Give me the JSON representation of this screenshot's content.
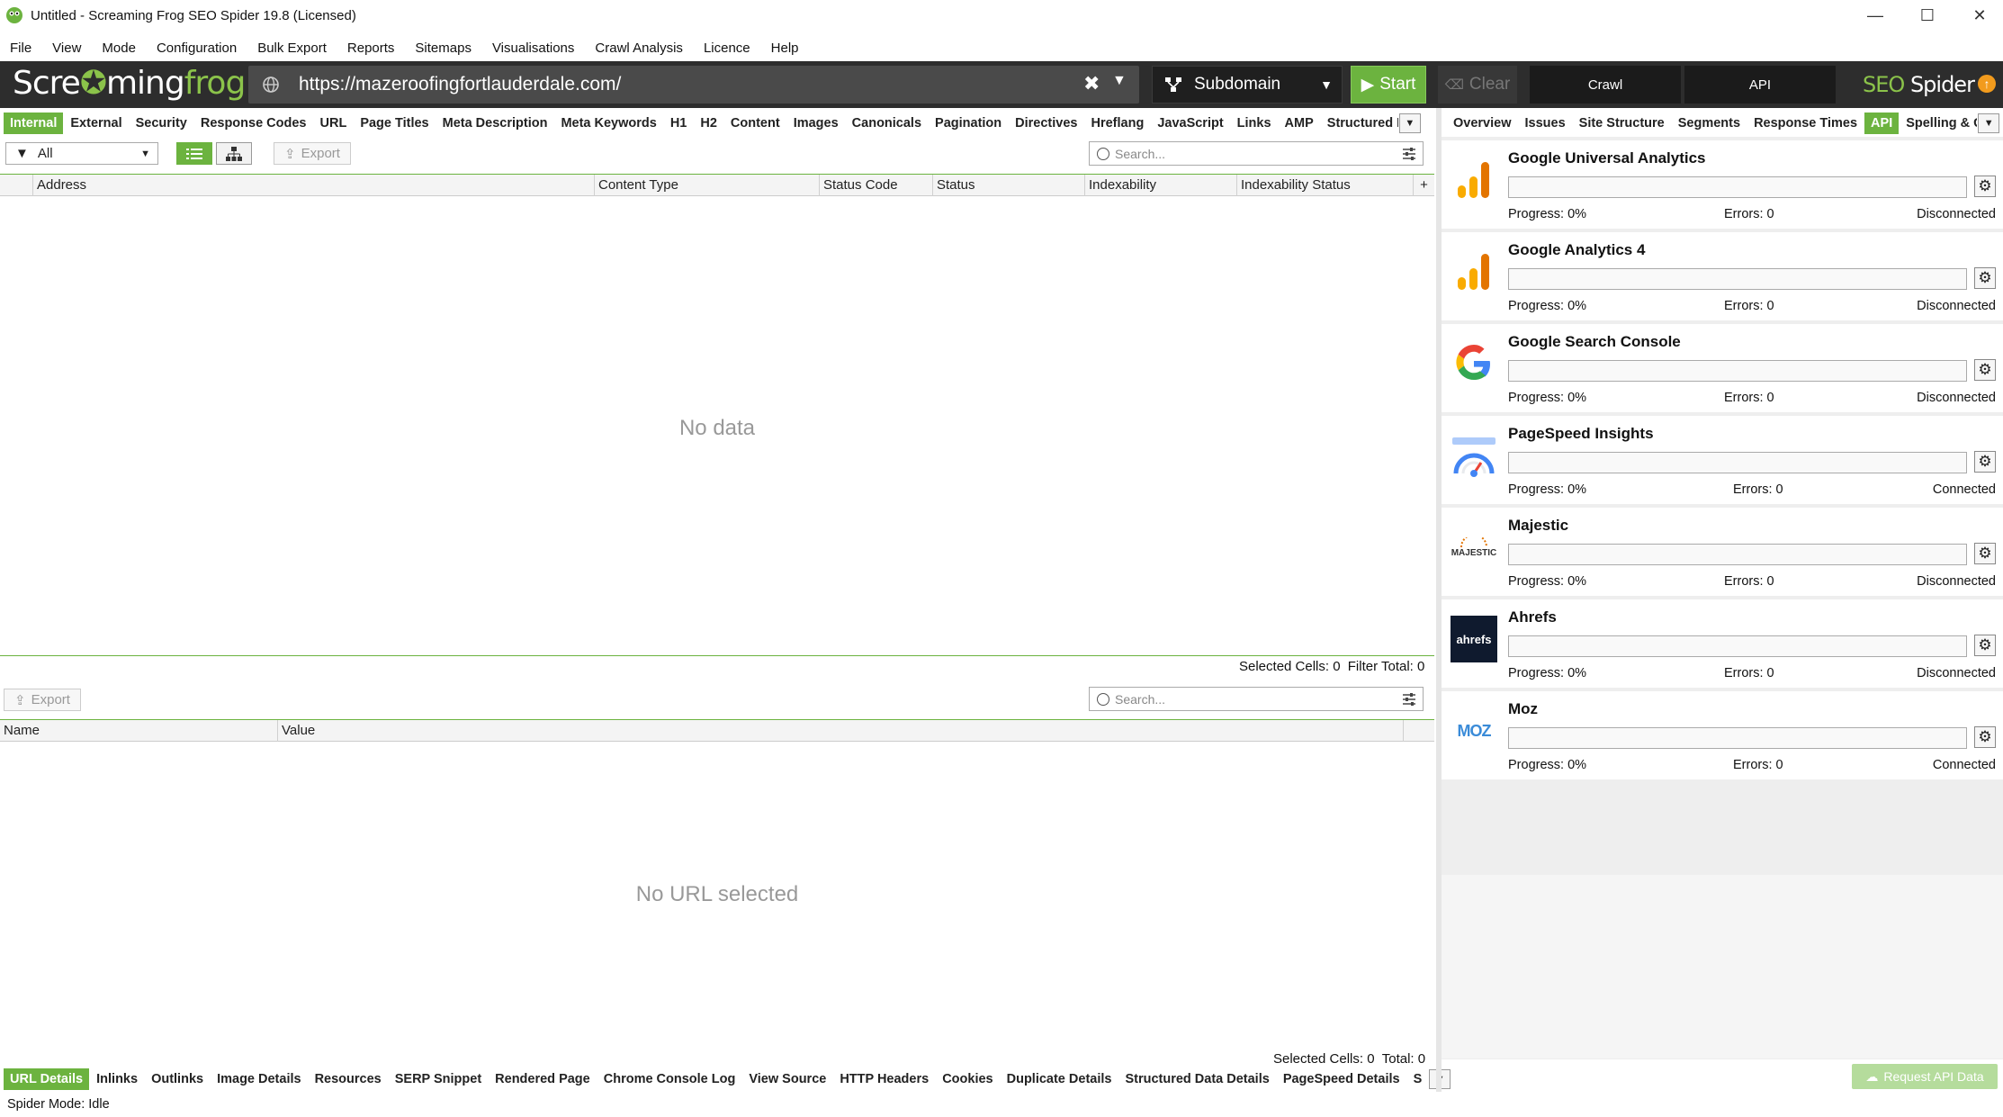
{
  "window": {
    "title": "Untitled - Screaming Frog SEO Spider 19.8 (Licensed)",
    "minimize": "—",
    "maximize": "☐",
    "close": "✕"
  },
  "menu": [
    "File",
    "View",
    "Mode",
    "Configuration",
    "Bulk Export",
    "Reports",
    "Sitemaps",
    "Visualisations",
    "Crawl Analysis",
    "Licence",
    "Help"
  ],
  "toolbar": {
    "logo_part1": "Scre",
    "logo_part2": "ming",
    "logo_part3": "frog",
    "url": "https://mazeroofingfortlauderdale.com/",
    "crawl_scope": "Subdomain",
    "start_label": "Start",
    "clear_label": "Clear",
    "crawl_mode": "Crawl",
    "api_mode": "API",
    "brand_seo": "SEO",
    "brand_spider": "Spider"
  },
  "main_tabs": [
    "Internal",
    "External",
    "Security",
    "Response Codes",
    "URL",
    "Page Titles",
    "Meta Description",
    "Meta Keywords",
    "H1",
    "H2",
    "Content",
    "Images",
    "Canonicals",
    "Pagination",
    "Directives",
    "Hreflang",
    "JavaScript",
    "Links",
    "AMP",
    "Structured D"
  ],
  "right_tabs": [
    "Overview",
    "Issues",
    "Site Structure",
    "Segments",
    "Response Times",
    "API",
    "Spelling & G"
  ],
  "filter": {
    "value": "All",
    "export_label": "Export",
    "search_placeholder": "Search..."
  },
  "grid": {
    "columns": [
      "Address",
      "Content Type",
      "Status Code",
      "Status",
      "Indexability",
      "Indexability Status"
    ],
    "empty_text": "No data",
    "selected_cells_label": "Selected Cells:",
    "selected_cells": "0",
    "filter_total_label": "Filter Total:",
    "filter_total": "0"
  },
  "lower": {
    "export_label": "Export",
    "search_placeholder": "Search...",
    "columns": [
      "Name",
      "Value"
    ],
    "empty_text": "No URL selected",
    "selected_cells_label": "Selected Cells:",
    "selected_cells": "0",
    "total_label": "Total:",
    "total": "0"
  },
  "bottom_tabs": [
    "URL Details",
    "Inlinks",
    "Outlinks",
    "Image Details",
    "Resources",
    "SERP Snippet",
    "Rendered Page",
    "Chrome Console Log",
    "View Source",
    "HTTP Headers",
    "Cookies",
    "Duplicate Details",
    "Structured Data Details",
    "PageSpeed Details",
    "S"
  ],
  "status_bar": "Spider Mode: Idle",
  "api_sources": [
    {
      "name": "Google Universal Analytics",
      "progress": "Progress: 0%",
      "errors": "Errors: 0",
      "status": "Disconnected",
      "icon": "google-analytics-icon"
    },
    {
      "name": "Google Analytics 4",
      "progress": "Progress: 0%",
      "errors": "Errors: 0",
      "status": "Disconnected",
      "icon": "google-analytics-icon"
    },
    {
      "name": "Google Search Console",
      "progress": "Progress: 0%",
      "errors": "Errors: 0",
      "status": "Disconnected",
      "icon": "google-g-icon"
    },
    {
      "name": "PageSpeed Insights",
      "progress": "Progress: 0%",
      "errors": "Errors: 0",
      "status": "Connected",
      "icon": "pagespeed-icon"
    },
    {
      "name": "Majestic",
      "progress": "Progress: 0%",
      "errors": "Errors: 0",
      "status": "Disconnected",
      "icon": "majestic-icon",
      "logo_text": "MAJESTIC"
    },
    {
      "name": "Ahrefs",
      "progress": "Progress: 0%",
      "errors": "Errors: 0",
      "status": "Disconnected",
      "icon": "ahrefs-icon",
      "logo_text": "ahrefs"
    },
    {
      "name": "Moz",
      "progress": "Progress: 0%",
      "errors": "Errors: 0",
      "status": "Connected",
      "icon": "moz-icon",
      "logo_text": "MOZ"
    }
  ],
  "request_api_label": "Request API Data",
  "colors": {
    "accent_green": "#6cb33f",
    "toolbar_bg": "#2d2d2d",
    "update_orange": "#f29b1d"
  }
}
